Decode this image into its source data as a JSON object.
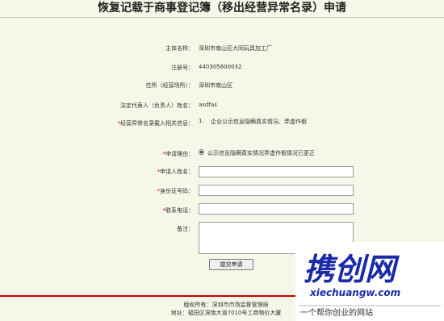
{
  "page": {
    "title": "恢复记载于商事登记簿（移出经营异常名录）申请"
  },
  "info": {
    "subject_label": "主体名称：",
    "subject_value": "深圳市南山区大同玩具加工厂",
    "reg_no_label": "注册号：",
    "reg_no_value": "440305600032",
    "address_label": "住所（经营场所）：",
    "address_value": "深圳市南山区",
    "legal_rep_label": "法定代表人（负责人）姓名：",
    "legal_rep_value": "asdfas",
    "abnormal_label": "经营异常名录载入相关信息：",
    "abnormal_index": "1.",
    "abnormal_value": "企业公示信息隐瞒真实情况、弄虚作假"
  },
  "form": {
    "reason_label": "申请理由：",
    "reason_option": "公示信息隐瞒真实情况弄虚作假情况已更正",
    "applicant_label": "申请人姓名：",
    "applicant_value": "",
    "id_label": "身份证号码：",
    "id_value": "",
    "phone_label": "联系电话：",
    "phone_value": "",
    "remark_label": "备注：",
    "remark_value": "",
    "required_mark": "*",
    "submit_label": "提交申请"
  },
  "footer": {
    "copyright": "版权所有：深圳市市场监督管理局",
    "address": "地址：福田区深南大道7010号工商物价大厦"
  },
  "watermark": {
    "brand": "携创网",
    "url": "xiechuangw.com",
    "slogan": "一个帮你创业的网站",
    "color": "#1a2aa8"
  }
}
